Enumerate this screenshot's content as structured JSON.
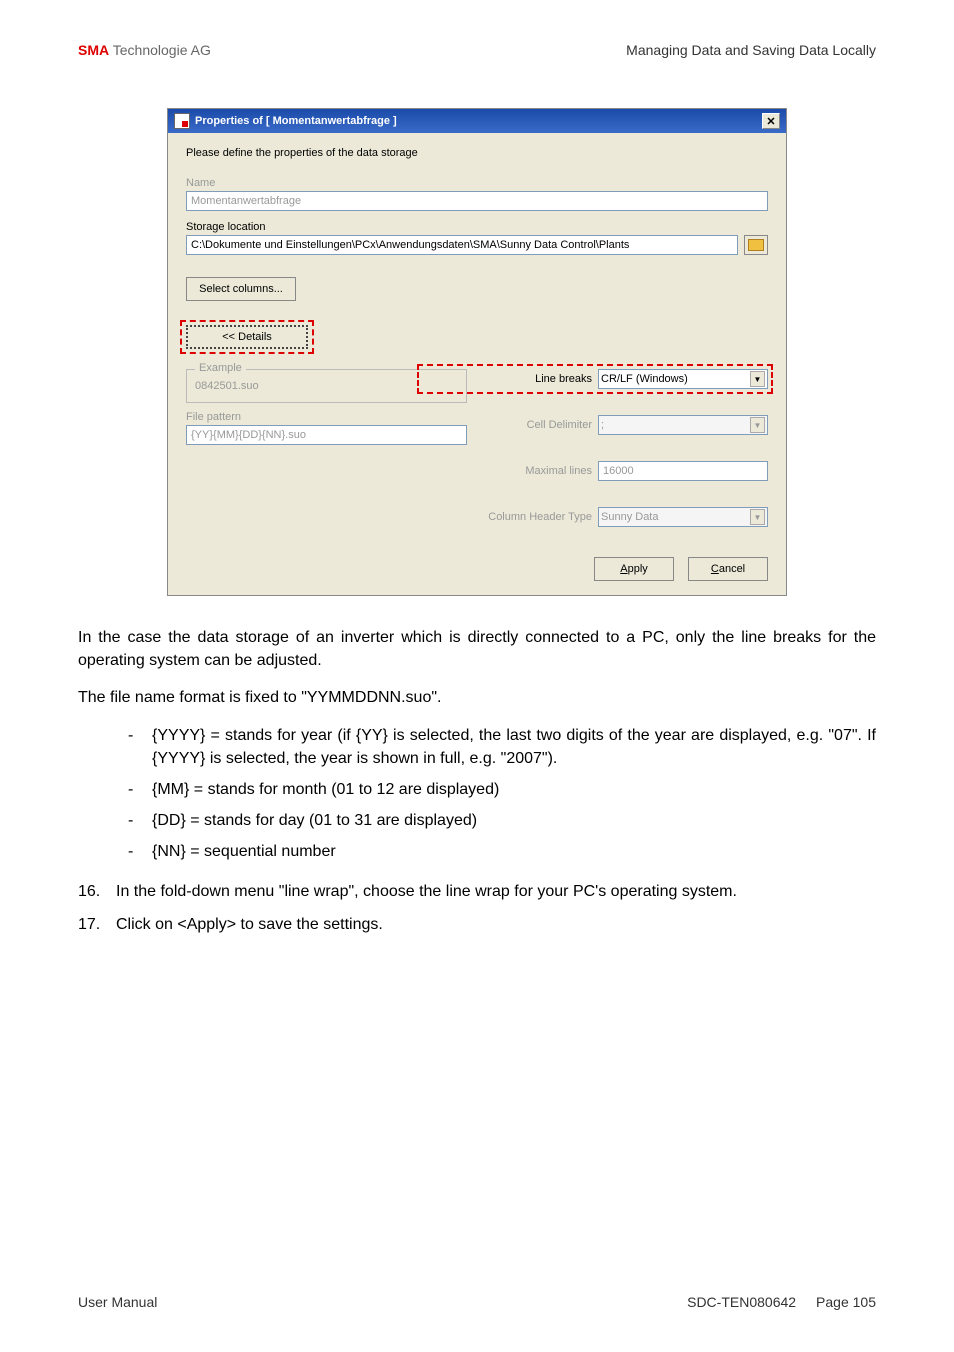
{
  "header": {
    "brand": "SMA",
    "company": " Technologie AG",
    "section": "Managing Data and Saving Data Locally"
  },
  "dialog": {
    "title": "Properties of [ Momentanwertabfrage ]",
    "instruction": "Please define the properties of the data storage",
    "name_label": "Name",
    "name_value": "Momentanwertabfrage",
    "storage_label": "Storage location",
    "storage_value": "C:\\Dokumente und Einstellungen\\PCx\\Anwendungsdaten\\SMA\\Sunny Data Control\\Plants",
    "select_columns": "Select columns...",
    "details": "<< Details",
    "example_label": "Example",
    "example_value": "0842501.suo",
    "file_pattern_label": "File pattern",
    "file_pattern_value": "{YY}{MM}{DD}{NN}.suo",
    "line_breaks_label": "Line breaks",
    "line_breaks_value": "CR/LF (Windows)",
    "cell_delimiter_label": "Cell Delimiter",
    "cell_delimiter_value": ";",
    "max_lines_label": "Maximal lines",
    "max_lines_value": "16000",
    "column_header_label": "Column Header Type",
    "column_header_value": "Sunny Data",
    "apply": "Apply",
    "cancel": "Cancel"
  },
  "text": {
    "para1": "In the case the data storage of an inverter which is directly connected to a PC, only the line breaks for the operating system can be adjusted.",
    "para2": "The file name format is fixed to \"YYMMDDNN.suo\".",
    "bullets": [
      "{YYYY} = stands for year (if {YY} is selected, the last two digits of the year are displayed, e.g. \"07\". If {YYYY} is selected, the year is shown in full, e.g. \"2007\").",
      "{MM} = stands for month (01 to 12 are displayed)",
      "{DD} = stands for day (01 to 31 are displayed)",
      "{NN} = sequential number"
    ],
    "step16_num": "16.",
    "step16": "In the fold-down menu \"line wrap\", choose the line wrap for your PC's operating system.",
    "step17_num": "17.",
    "step17": "Click on <Apply> to save the settings."
  },
  "footer": {
    "left": "User Manual",
    "doc": "SDC-TEN080642",
    "page": "Page 105"
  }
}
